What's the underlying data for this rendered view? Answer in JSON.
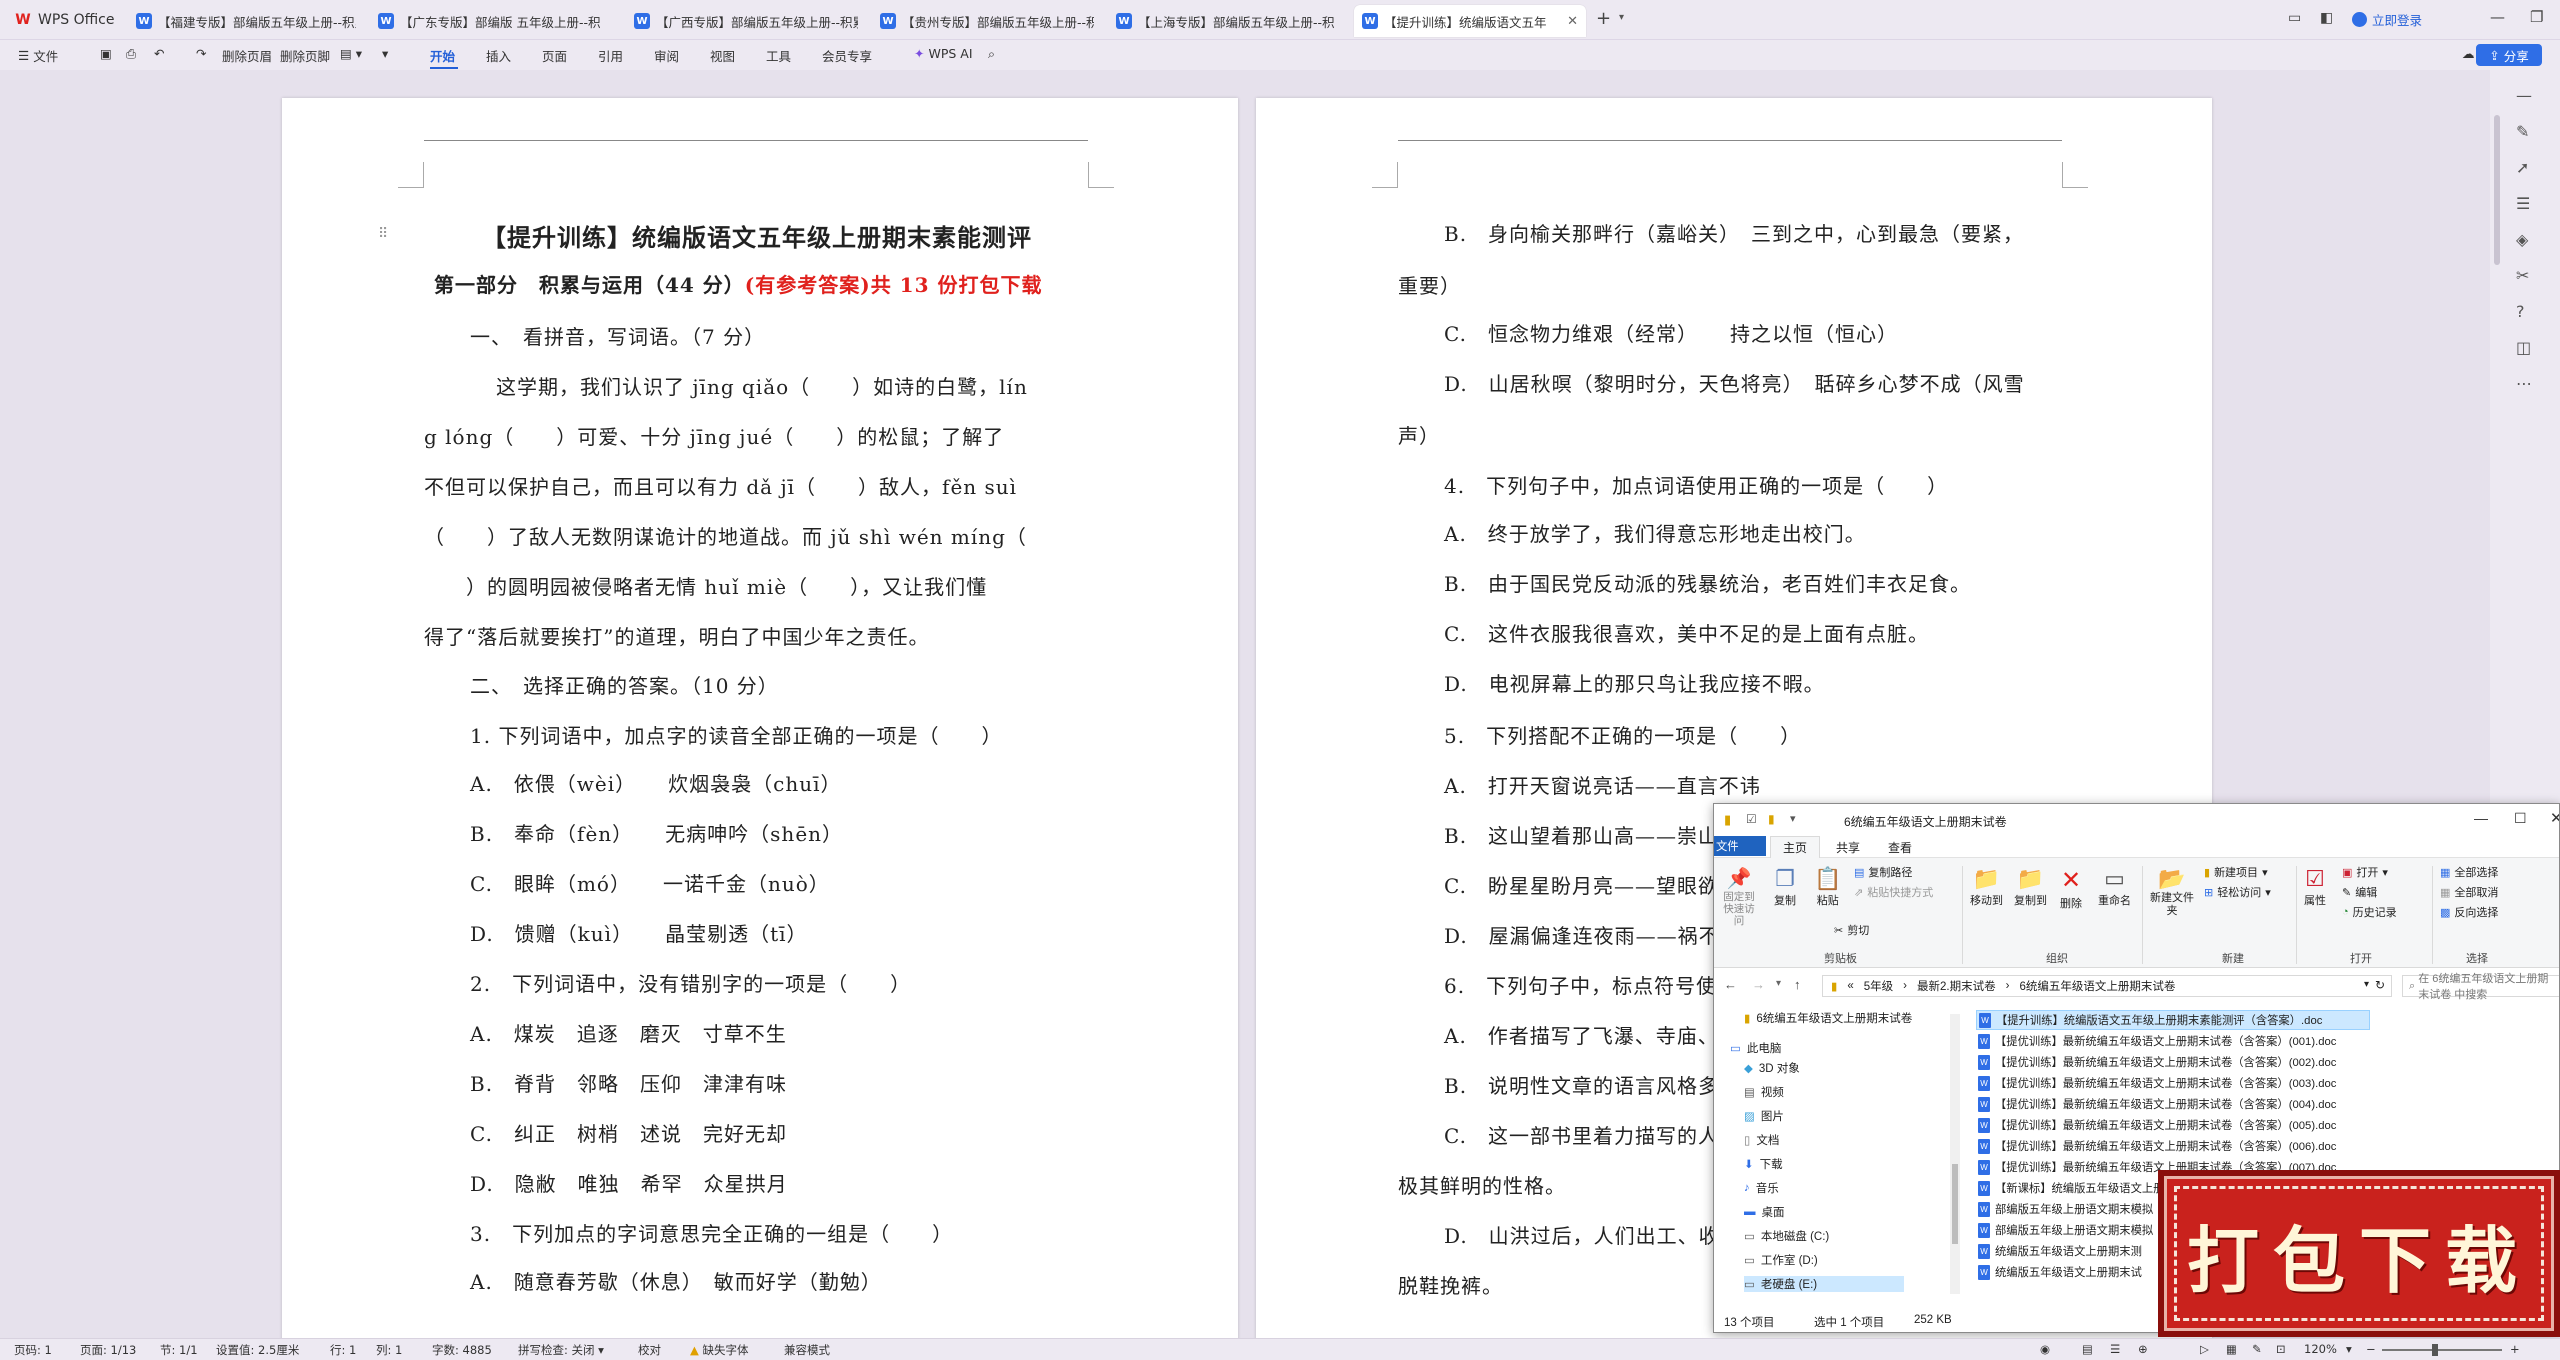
{
  "titlebar": {
    "app_name": "WPS Office",
    "tabs": [
      {
        "label": "【福建专版】部编版五年级上册--积累"
      },
      {
        "label": "【广东专版】部编版 五年级上册--积"
      },
      {
        "label": "【广西专版】部编版五年级上册--积累"
      },
      {
        "label": "【贵州专版】部编版五年级上册--积累"
      },
      {
        "label": "【上海专版】部编版五年级上册--积"
      },
      {
        "label": "【提升训练】统编版语文五年"
      }
    ],
    "login": "立即登录"
  },
  "toolbar": {
    "file": "文件",
    "delete_header": "删除页眉",
    "delete_footer": "删除页脚",
    "tabs": [
      "开始",
      "插入",
      "页面",
      "引用",
      "审阅",
      "视图",
      "工具",
      "会员专享"
    ],
    "wps_ai": "WPS AI",
    "share": "分享"
  },
  "page1": {
    "title": "【提升训练】统编版语文五年级上册期末素能测评",
    "subtitle_main": "第一部分　积累与运用（44 分）",
    "subtitle_red": "(有参考答案)共 13 份打包下载",
    "lines": [
      "一、　看拼音，写词语。（7 分）",
      "这学期，我们认识了 jīng qiǎo（　　）如诗的白鹭，lín",
      "g lóng（　　）可爱、十分 jīng jué（　　）的松鼠；了解了",
      "不但可以保护自己，而且可以有力 dǎ jī（　　）敌人，fěn suì",
      "（　　）了敌人无数阴谋诡计的地道战。而 jǔ shì wén míng（",
      "　　）的圆明园被侵略者无情 huǐ miè（　　），又让我们懂",
      "得了“落后就要挨打”的道理，明白了中国少年之责任。",
      "二、　选择正确的答案。（10 分）",
      "1. 下列词语中，加点字的读音全部正确的一项是（　　）",
      "A.　依偎（wèi）　　炊烟袅袅（chuī）",
      "B.　奉命（fèn）　　无病呻吟（shēn）",
      "C.　眼眸（mó）　　一诺千金（nuò）",
      "D.　馈赠（kuì）　　晶莹剔透（tī）",
      "2.　下列词语中，没有错别字的一项是（　　）",
      "A.　煤炭　追逐　磨灭　寸草不生",
      "B.　脊背　邻略　压仰　津津有味",
      "C.　纠正　树梢　述说　完好无却",
      "D.　隐敝　唯独　希罕　众星拱月",
      "3.　下列加点的字词意思完全正确的一组是（　　）",
      "A.　随意春芳歇（休息）　敏而好学（勤勉）"
    ]
  },
  "page2": {
    "lines": [
      "B.　身向榆关那畔行（嘉峪关）　三到之中，心到最急（要紧，",
      "重要）",
      "C.　恒念物力维艰（经常）　　持之以恒（恒心）",
      "D.　山居秋暝（黎明时分，天色将亮）　聒碎乡心梦不成（风雪",
      "声）",
      "4.　下列句子中，加点词语使用正确的一项是（　　）",
      "A.　终于放学了，我们得意忘形地走出校门。",
      "B.　由于国民党反动派的残暴统治，老百姓们丰衣足食。",
      "C.　这件衣服我很喜欢，美中不足的是上面有点脏。",
      "D.　电视屏幕上的那只鸟让我应接不暇。",
      "5.　下列搭配不正确的一项是（　　）",
      "A.　打开天窗说亮话——直言不讳",
      "B.　这山望着那山高——崇山",
      "C.　盼星星盼月亮——望眼欲",
      "D.　屋漏偏逢连夜雨——祸不",
      "6.　下列句子中，标点符号使",
      "A.　作者描写了飞瀑、寺庙、",
      "B.　说明性文章的语言风格多",
      "C.　这一部书里着力描写的人",
      "极其鲜明的性格。",
      "D.　山洪过后，人们出工、收",
      "脱鞋挽裤。"
    ]
  },
  "explorer": {
    "title": "6统编五年级语文上册期末试卷",
    "tabs": [
      "文件",
      "主页",
      "共享",
      "查看"
    ],
    "ribbon": {
      "pin": "固定到快速访问",
      "copy": "复制",
      "paste": "粘贴",
      "copy_path": "复制路径",
      "paste_shortcut": "粘贴快捷方式",
      "cut": "剪切",
      "move_to": "移动到",
      "copy_to": "复制到",
      "delete": "删除",
      "rename": "重命名",
      "new_folder": "新建文件夹",
      "new_item": "新建项目",
      "easy_access": "轻松访问",
      "properties": "属性",
      "open": "打开",
      "edit": "编辑",
      "history": "历史记录",
      "select_all": "全部选择",
      "select_none": "全部取消",
      "invert": "反向选择",
      "groups": [
        "剪贴板",
        "组织",
        "新建",
        "打开",
        "选择"
      ]
    },
    "breadcrumb": [
      "5年级",
      "最新2.期末试卷",
      "6统编五年级语文上册期末试卷"
    ],
    "search_placeholder": "在 6统编五年级语文上册期末试卷 中搜索",
    "nav": [
      "6统编五年级语文上册期末试卷",
      "此电脑",
      "3D 对象",
      "视频",
      "图片",
      "文档",
      "下载",
      "音乐",
      "桌面",
      "本地磁盘 (C:)",
      "工作室 (D:)",
      "老硬盘 (E:)"
    ],
    "files": [
      "【提升训练】统编版语文五年级上册期末素能测评（含答案）.doc",
      "【提优训练】最新统编五年级语文上册期末试卷（含答案）(001).doc",
      "【提优训练】最新统编五年级语文上册期末试卷（含答案）(002).doc",
      "【提优训练】最新统编五年级语文上册期末试卷（含答案）(003).doc",
      "【提优训练】最新统编五年级语文上册期末试卷（含答案）(004).doc",
      "【提优训练】最新统编五年级语文上册期末试卷（含答案）(005).doc",
      "【提优训练】最新统编五年级语文上册期末试卷（含答案）(006).doc",
      "【提优训练】最新统编五年级语文上册期末试卷（含答案）(007).doc",
      "【新课标】统编版五年级语文上册期末",
      "部编版五年级上册语文期末模拟",
      "部编版五年级上册语文期末模拟",
      "统编版五年级语文上册期末测",
      "统编版五年级语文上册期末试"
    ],
    "status": {
      "count": "13 个项目",
      "selected": "选中 1 个项目",
      "size": "252 KB"
    }
  },
  "stamp": {
    "text": "打包下载"
  },
  "statusbar": {
    "page": "页码: 1",
    "pages": "页面: 1/13",
    "section": "节: 1/1",
    "setting": "设置值: 2.5厘米",
    "row": "行: 1",
    "col": "列: 1",
    "words": "字数: 4885",
    "spell": "拼写检查: 关闭",
    "proof": "校对",
    "missing_font": "缺失字体",
    "compat": "兼容模式",
    "zoom": "120%"
  }
}
